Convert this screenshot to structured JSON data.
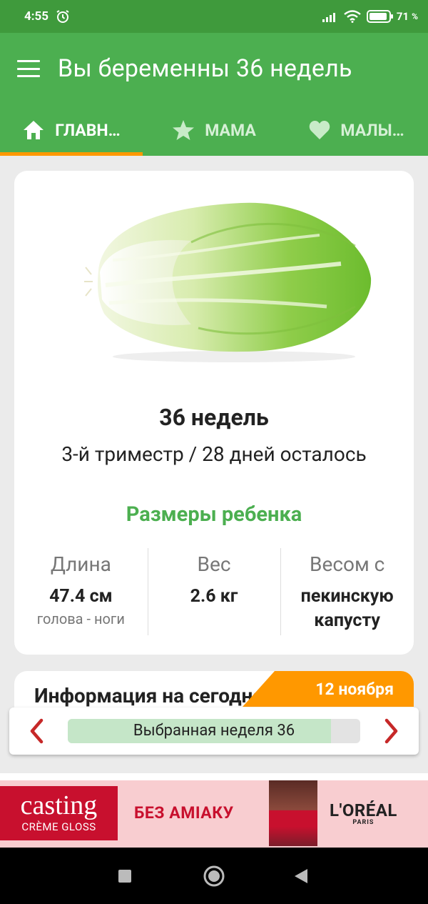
{
  "status_bar": {
    "time": "4:55",
    "battery_percent": "71",
    "battery_unit": "%"
  },
  "toolbar": {
    "title": "Вы беременны 36 недель"
  },
  "tabs": [
    {
      "label": "ГЛАВН…",
      "icon": "home-icon",
      "active": true
    },
    {
      "label": "МАМА",
      "icon": "star-icon",
      "active": false
    },
    {
      "label": "МАЛЫ…",
      "icon": "heart-icon",
      "active": false
    }
  ],
  "summary": {
    "image": "chinese-cabbage",
    "weeks_title": "36 недель",
    "trimester_text": "3-й триместр / 28 дней осталось"
  },
  "baby_size": {
    "title": "Размеры ребенка",
    "stats": [
      {
        "label": "Длина",
        "value": "47.4 см",
        "note": "голова - ноги"
      },
      {
        "label": "Вес",
        "value": "2.6 кг",
        "note": ""
      },
      {
        "label": "Весом с",
        "value_line1": "пекинскую",
        "value_line2": "капусту"
      }
    ]
  },
  "today": {
    "title": "Информация на сегодня",
    "date": "12 ноября"
  },
  "week_selector": {
    "label": "Выбранная неделя 36",
    "progress_fraction": 0.9
  },
  "ad": {
    "logo_main": "casting",
    "logo_sub": "CRÈME GLOSS",
    "text": "БЕЗ АМІАКУ",
    "brand": "L'ORÉAL",
    "brand_sub": "PARIS"
  },
  "colors": {
    "status_bar": "#3f9a3c",
    "primary": "#4caf50",
    "accent": "#ff9800",
    "arrow": "#c62828",
    "progress_fill": "#c5e6c8"
  }
}
